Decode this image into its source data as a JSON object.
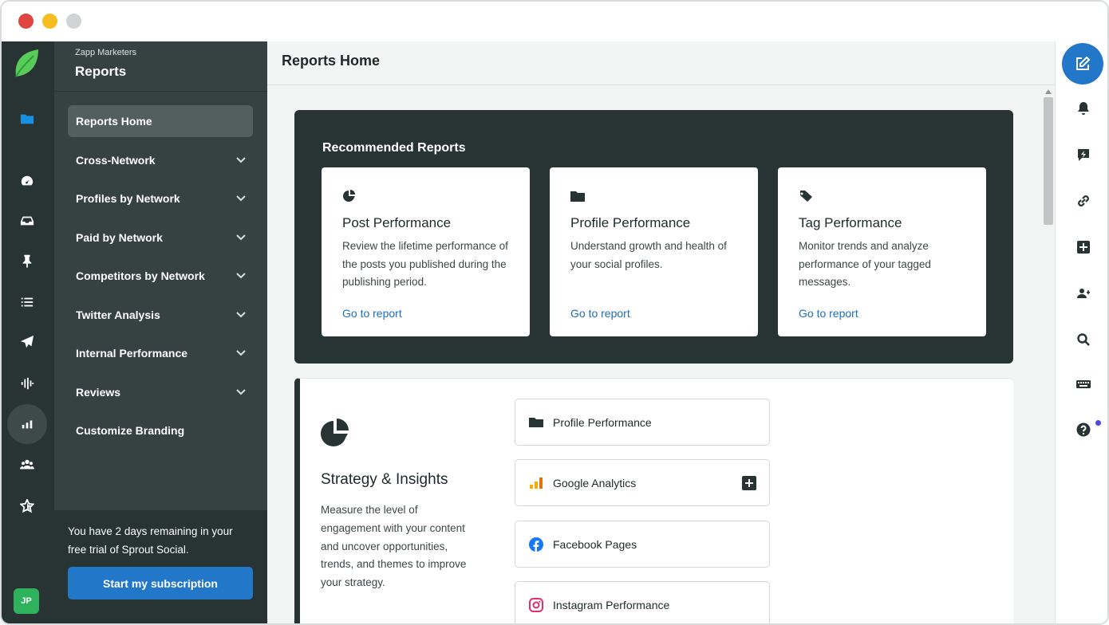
{
  "app": {
    "org": "Zapp Marketers",
    "section": "Reports",
    "avatar_initials": "JP",
    "accent": "#2277c8",
    "rail_bg": "#273433"
  },
  "nav": {
    "items": [
      {
        "label": "Reports Home",
        "active": true
      },
      {
        "label": "Cross-Network",
        "expandable": true
      },
      {
        "label": "Profiles by Network",
        "expandable": true
      },
      {
        "label": "Paid by Network",
        "expandable": true
      },
      {
        "label": "Competitors by Network",
        "expandable": true
      },
      {
        "label": "Twitter Analysis",
        "expandable": true
      },
      {
        "label": "Internal Performance",
        "expandable": true
      },
      {
        "label": "Reviews",
        "expandable": true
      },
      {
        "label": "Customize Branding"
      }
    ],
    "trial_text": "You have 2 days remaining in your free trial of Sprout Social.",
    "subscribe_label": "Start my subscription"
  },
  "main": {
    "title": "Reports Home",
    "recommended": {
      "title": "Recommended Reports",
      "cards": [
        {
          "icon": "pie-chart-icon",
          "title": "Post Performance",
          "desc": "Review the lifetime performance of the posts you published during the publishing period.",
          "link": "Go to report"
        },
        {
          "icon": "folder-icon",
          "title": "Profile Performance",
          "desc": "Understand growth and health of your social profiles.",
          "link": "Go to report"
        },
        {
          "icon": "tag-icon",
          "title": "Tag Performance",
          "desc": "Monitor trends and analyze performance of your tagged messages.",
          "link": "Go to report"
        }
      ]
    },
    "strategy": {
      "title": "Strategy & Insights",
      "desc": "Measure the level of engagement with your content and uncover opportunities, trends, and themes to improve your strategy.",
      "items": [
        {
          "label": "Profile Performance",
          "icon": "folder-icon"
        },
        {
          "label": "Google Analytics",
          "icon": "google-analytics-icon",
          "addable": true
        },
        {
          "label": "Facebook Pages",
          "icon": "facebook-icon"
        },
        {
          "label": "Instagram Performance",
          "icon": "instagram-icon"
        }
      ]
    }
  }
}
